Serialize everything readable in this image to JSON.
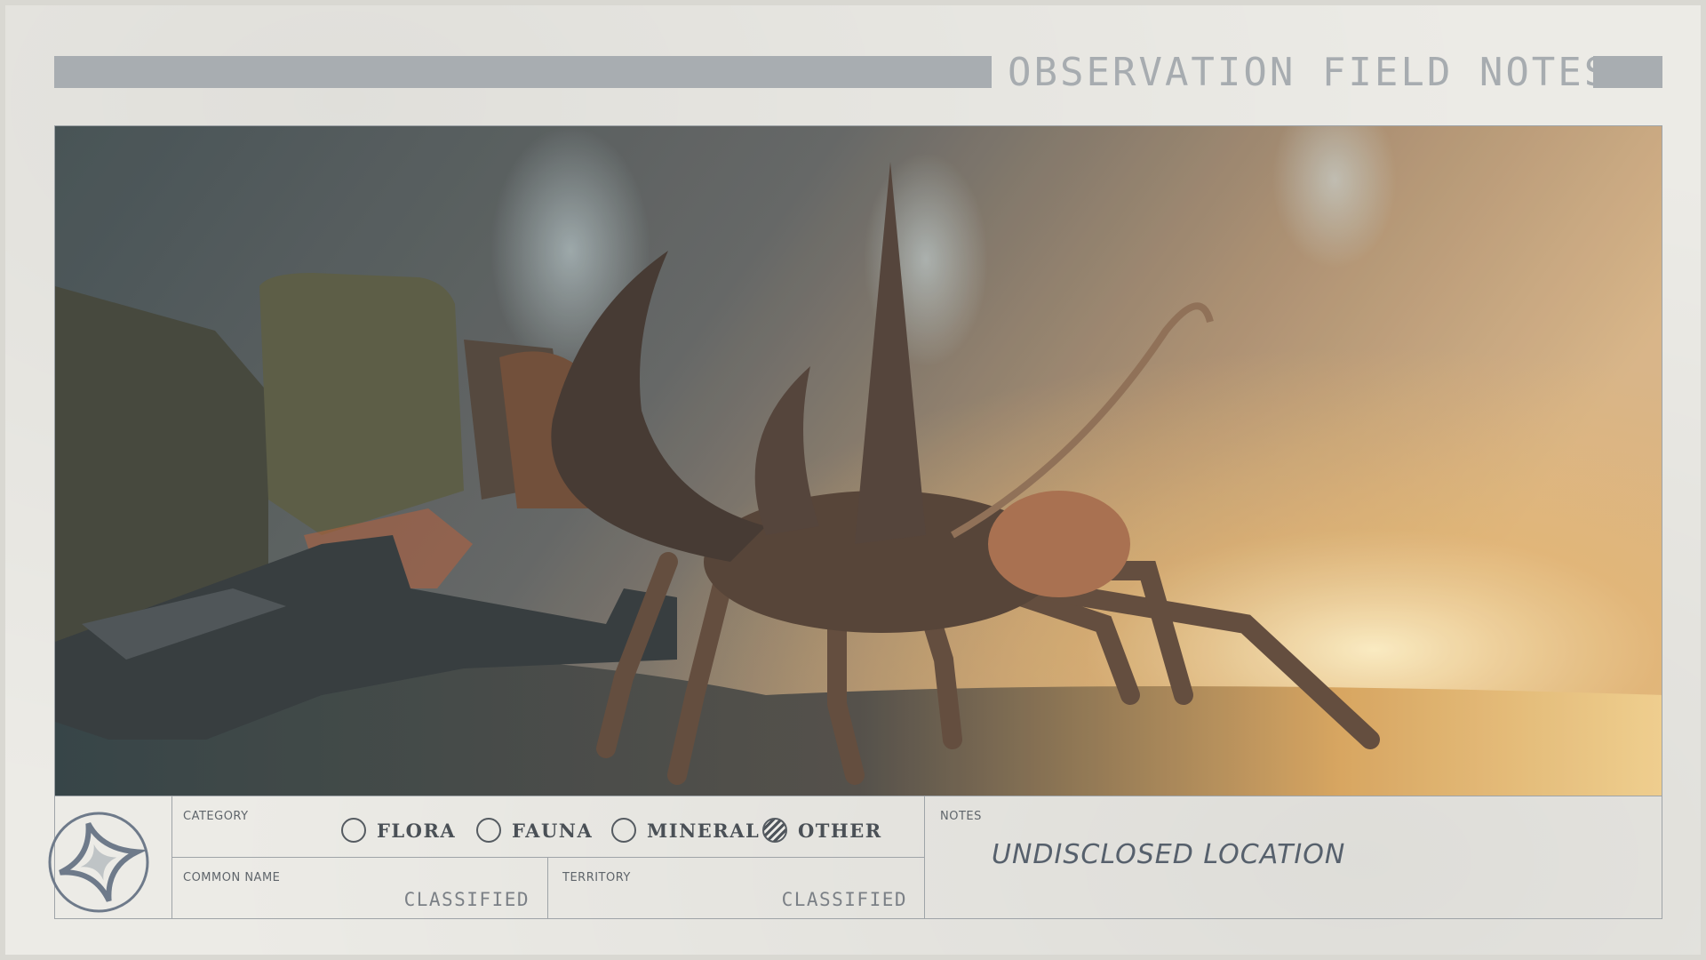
{
  "header": {
    "title": "OBSERVATION FIELD NOTES"
  },
  "form": {
    "category_label": "CATEGORY",
    "options": [
      {
        "label": "FLORA",
        "checked": false
      },
      {
        "label": "FAUNA",
        "checked": false
      },
      {
        "label": "MINERAL",
        "checked": false
      },
      {
        "label": "OTHER",
        "checked": true
      }
    ],
    "common_name_label": "COMMON NAME",
    "common_name_value": "CLASSIFIED",
    "territory_label": "TERRITORY",
    "territory_value": "CLASSIFIED",
    "notes_label": "NOTES",
    "notes_value": "UNDISCLOSED LOCATION"
  },
  "icons": {
    "emblem": "four-point-star-emblem-icon"
  },
  "colors": {
    "paper": "#ecebe6",
    "bar": "#a8adb1",
    "ink": "#4a5056"
  }
}
